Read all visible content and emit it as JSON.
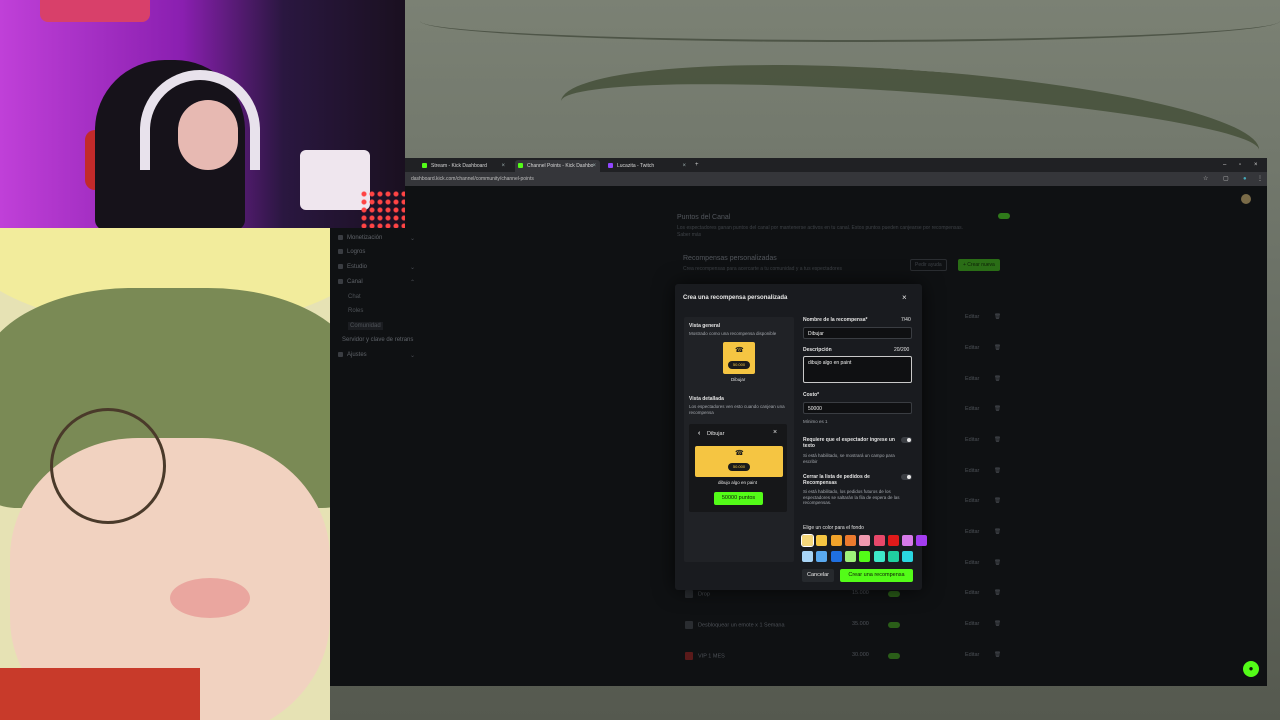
{
  "browser": {
    "tabs": [
      {
        "label": "Stream - Kick Dashboard",
        "active": false
      },
      {
        "label": "Channel Points - Kick Dashbo",
        "active": true
      },
      {
        "label": "Lucazita - Twitch",
        "active": false
      }
    ],
    "new_tab": "+",
    "url": "dashboard.kick.com/channel/community/channel-points"
  },
  "sidebar": {
    "items": [
      {
        "label": "Monetización",
        "chevron": "⌄"
      },
      {
        "label": "Logros",
        "chevron": ""
      },
      {
        "label": "Estudio",
        "chevron": "⌄"
      },
      {
        "label": "Canal",
        "chevron": "⌃"
      }
    ],
    "subitems": [
      "Chat",
      "Roles",
      "Comunidad"
    ],
    "bottom": [
      {
        "label": "Servidor y clave de retrans"
      },
      {
        "label": "Ajustes",
        "chevron": "⌄"
      }
    ]
  },
  "background_page": {
    "title": "Puntos del Canal",
    "description": "Los espectadores ganan puntos del canal por mantenerse activos en tu canal. Estos puntos pueden canjearse por recompensas.",
    "learn_more": "Saber más",
    "section_title": "Recompensas personalizadas",
    "section_desc": "Crea recompensas para acercarte a tu comunidad y a tus espectadores",
    "btn_secondary": "Pedir ayuda",
    "btn_primary": "+ Crear nueva",
    "edit_label": "Editar",
    "delete_icon": "🗑",
    "rows": [
      {
        "name": "Drop",
        "cost": "15.000"
      },
      {
        "name": "Desbloquear un emote x 1 Semana",
        "cost": "35.000"
      },
      {
        "name": "VIP 1 MES",
        "cost": "30.000"
      }
    ]
  },
  "modal": {
    "title": "Crea una recompensa personalizada",
    "close": "×",
    "overview_label": "Vista general",
    "overview_desc": "Mostrado como una recompensa disponible",
    "card_cost": "50.000",
    "card_name": "Dibujar",
    "detail_label": "Vista detallada",
    "detail_desc": "Los espectadores ven esto cuando canjean una recompensa",
    "detail_back": "‹",
    "detail_title": "Dibujar",
    "detail_close": "×",
    "detail_cost": "50.000",
    "detail_desc_text": "dibujo algo en paint",
    "redeem_button": "50000 puntos",
    "name_label": "Nombre de la recompensa*",
    "name_count": "7/40",
    "name_value": "Dibujar",
    "desc_label": "Descripción",
    "desc_count": "20/200",
    "desc_value": "dibujo algo en paint",
    "cost_label": "Costo*",
    "cost_value": "50000",
    "cost_hint": "Mínimo es 1",
    "require_text_label": "Requiere que el espectador ingrese un texto",
    "require_text_hint": "Si está habilitado, se mostrará un campo para escribir",
    "close_queue_label": "Cerrar la lista de pedidos de Recompensas",
    "close_queue_hint": "Si está habilitado, los pedidos futuros de los espectadores se saltarán la fila de espera de las recompensas.",
    "color_label": "Elige un color para el fondo",
    "colors_row1": [
      "#f5d77a",
      "#f5c542",
      "#f0a32a",
      "#ec7a2e",
      "#f09ab0",
      "#e8486a",
      "#e01a1a",
      "#d67ae8",
      "#a33cf0"
    ],
    "colors_row2": [
      "#a8d4f5",
      "#5aa9ef",
      "#1f6fe0",
      "#9ef07a",
      "#53fc18",
      "#3ee8c9",
      "#20d0a0",
      "#2ad6e0"
    ],
    "cancel": "Cancelar",
    "create": "Crear una recompensa"
  },
  "fab_icon": "chat-bubble-icon"
}
